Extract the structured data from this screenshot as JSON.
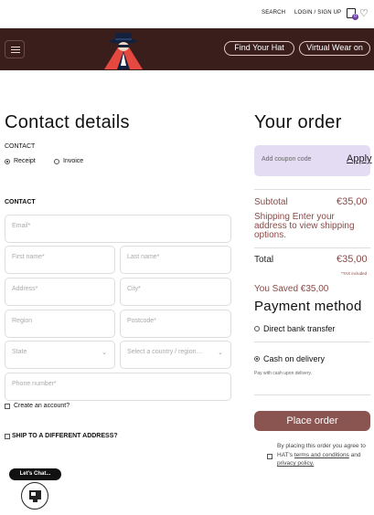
{
  "header": {
    "search_label": "SEARCH",
    "login_label": "LOGIN / SIGN UP",
    "cart_count": "0",
    "find_hat_label": "Find Your Hat",
    "virtual_wear_label": "Virtual Wear on"
  },
  "contact": {
    "title": "Contact details",
    "contact_label": "CONTACT",
    "receipt_label": "Receipt",
    "invoice_label": "Invoice",
    "contact_label_2": "CONTACT",
    "fields": {
      "email": "Email*",
      "first_name": "First name*",
      "last_name": "Last name*",
      "address": "Address*",
      "city": "City*",
      "region": "Region",
      "postcode": "Postcode*",
      "state": "State",
      "country": "Select a country / region…",
      "phone": "Phone number*"
    },
    "create_account_label": "Create an account?",
    "ship_different_label": "SHIP TO A DIFFERENT ADDRESS?"
  },
  "order": {
    "title": "Your order",
    "coupon_placeholder": "Add coupon code",
    "apply_label": "Apply",
    "subtotal_label": "Subtotal",
    "subtotal_value": "€35,00",
    "shipping_text": "Shipping Enter your address to view shipping options.",
    "total_label": "Total",
    "total_value": "€35,00",
    "tax_note": "*TAX included",
    "saved_text": "You Saved €35,00"
  },
  "payment": {
    "title": "Payment method",
    "direct_bank_label": "Direct bank transfer",
    "cod_label": "Cash on delivery",
    "cod_note": "Pay with cash upon delivery.",
    "place_order_label": "Place order",
    "terms_text_1": "By placing this order you agree to HAT's",
    "terms_link": "terms and conditions",
    "terms_and": "and",
    "privacy_link": "privacy policy."
  },
  "chat": {
    "bubble_label": "Let's Chat..."
  },
  "colors": {
    "brand_dark": "#3a1e1c",
    "accent_maroon": "#8a4a46",
    "coupon_bg": "#e3dcf2",
    "cart_badge": "#6b3fa0"
  }
}
